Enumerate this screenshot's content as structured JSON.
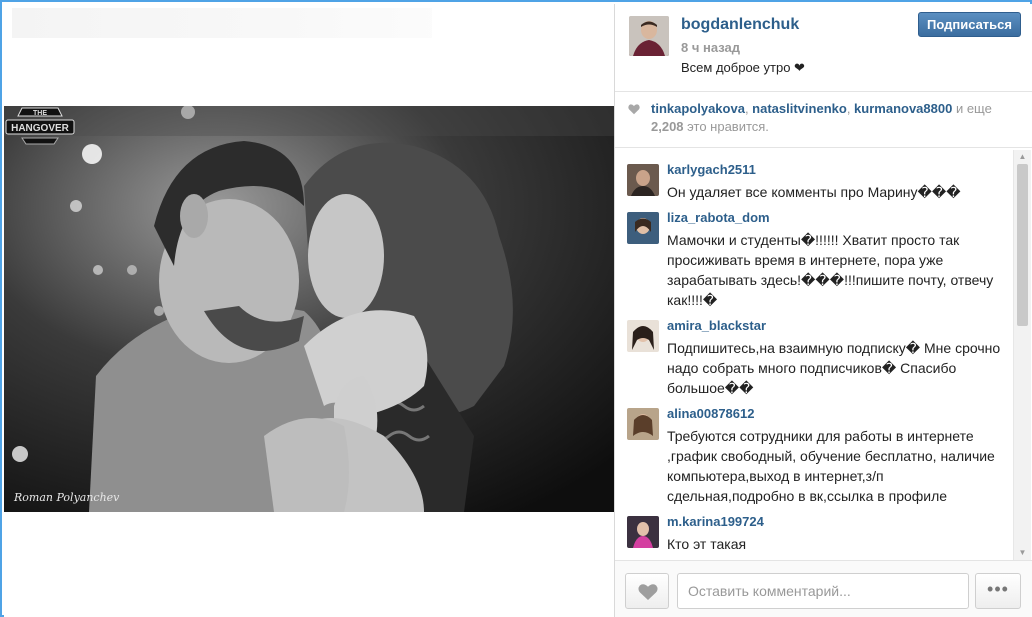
{
  "photo": {
    "credit": "Roman Polyanchev",
    "watermark_line1": "THE",
    "watermark_line2": "HANGOVER"
  },
  "post": {
    "username": "bogdanlenchuk",
    "time_ago": "8 ч назад",
    "caption": "Всем доброе утро ❤",
    "follow_label": "Подписаться"
  },
  "likes": {
    "user1": "tinkapolyakova",
    "sep1": ", ",
    "user2": "nataslitvinenko",
    "sep2": ", ",
    "user3": "kurmanova8800",
    "and_more": " и еще ",
    "count": "2,208",
    "suffix": " это нравится."
  },
  "comments": [
    {
      "user": "karlygach2511",
      "text": "Он удаляет все комменты про Марину���"
    },
    {
      "user": "liza_rabota_dom",
      "text": "Мамочки и студенты�!!!!!! Хватит просто так просиживать время в интернете, пора уже зарабатывать здесь!���!!!пишите почту, отвечу как!!!!�"
    },
    {
      "user": "amira_blackstar",
      "text": "Подпишитесь,на взаимную подписку� Мне срочно надо собрать много подписчиков� Спасибо большое��"
    },
    {
      "user": "alina00878612",
      "text": "Требуются сотрудники для работы в интернете ,график свободный, обучение бесплатно, наличие компьютера,выход в интернет,з/п сдельная,подробно в вк,ссылка в профиле"
    },
    {
      "user": "m.karina199724",
      "text": "Кто эт такая"
    }
  ],
  "footer": {
    "comment_placeholder": "Оставить комментарий...",
    "more_label": "•••"
  },
  "icons": {
    "likes_heart": "heart-icon",
    "like_button": "heart-icon",
    "more": "ellipsis-icon"
  }
}
